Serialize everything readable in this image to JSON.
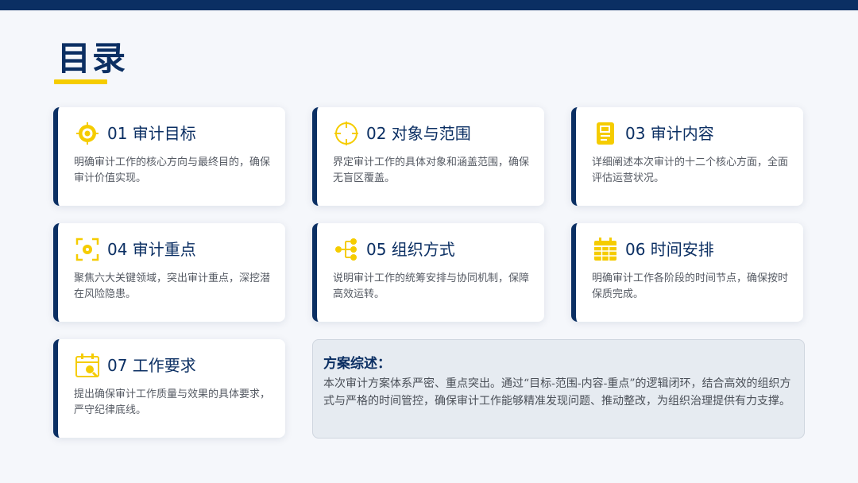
{
  "page": {
    "title": "目录"
  },
  "colors": {
    "navy": "#0b2f63",
    "accent_yellow": "#f5cc00",
    "card_bg": "#ffffff",
    "summary_bg": "#e6ebf1"
  },
  "cards": [
    {
      "title": "01 审计目标",
      "desc": "明确审计工作的核心方向与最终目的，确保审计价值实现。",
      "icon": "target-icon"
    },
    {
      "title": "02 对象与范围",
      "desc": "界定审计工作的具体对象和涵盖范围，确保无盲区覆盖。",
      "icon": "crosshair-icon"
    },
    {
      "title": "03 审计内容",
      "desc": "详细阐述本次审计的十二个核心方面，全面评估运营状况。",
      "icon": "document-icon"
    },
    {
      "title": "04 审计重点",
      "desc": "聚焦六大关键领域，突出审计重点，深挖潜在风险隐患。",
      "icon": "focus-icon"
    },
    {
      "title": "05 组织方式",
      "desc": "说明审计工作的统筹安排与协同机制，保障高效运转。",
      "icon": "org-tree-icon"
    },
    {
      "title": "06 时间安排",
      "desc": "明确审计工作各阶段的时间节点，确保按时保质完成。",
      "icon": "calendar-icon"
    },
    {
      "title": "07 工作要求",
      "desc": "提出确保审计工作质量与效果的具体要求，严守纪律底线。",
      "icon": "calendar-search-icon"
    }
  ],
  "summary": {
    "title": "方案综述：",
    "text": "本次审计方案体系严密、重点突出。通过“目标-范围-内容-重点”的逻辑闭环，结合高效的组织方式与严格的时间管控，确保审计工作能够精准发现问题、推动整改，为组织治理提供有力支撑。"
  }
}
